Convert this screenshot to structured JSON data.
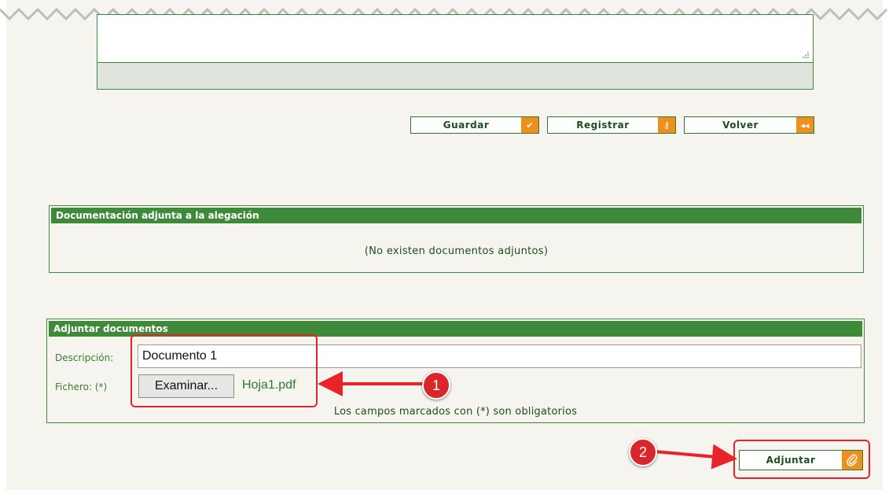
{
  "buttons": {
    "guardar": {
      "label": "Guardar",
      "icon": "check-icon",
      "glyph": "✔"
    },
    "registrar": {
      "label": "Registrar",
      "icon": "key-icon",
      "glyph": "⚷"
    },
    "volver": {
      "label": "Volver",
      "icon": "rewind-icon",
      "glyph": "◂◂"
    }
  },
  "docs_panel": {
    "title": "Documentación adjunta a la alegación",
    "empty_message": "(No existen documentos adjuntos)"
  },
  "attach_panel": {
    "title": "Adjuntar documentos",
    "description_label": "Descripción:",
    "description_value": "Documento 1",
    "file_label": "Fichero: (*)",
    "browse_label": "Examinar...",
    "file_name": "Hoja1.pdf",
    "required_note": "Los campos marcados con (*) son obligatorios"
  },
  "attach_button": {
    "label": "Adjuntar",
    "icon": "paperclip-icon"
  },
  "annotations": {
    "step1": "1",
    "step2": "2"
  },
  "colors": {
    "primary_green": "#3f8a3a",
    "accent_orange": "#f0901c",
    "annotation_red": "#e8232a",
    "background": "#f5f4ef"
  }
}
